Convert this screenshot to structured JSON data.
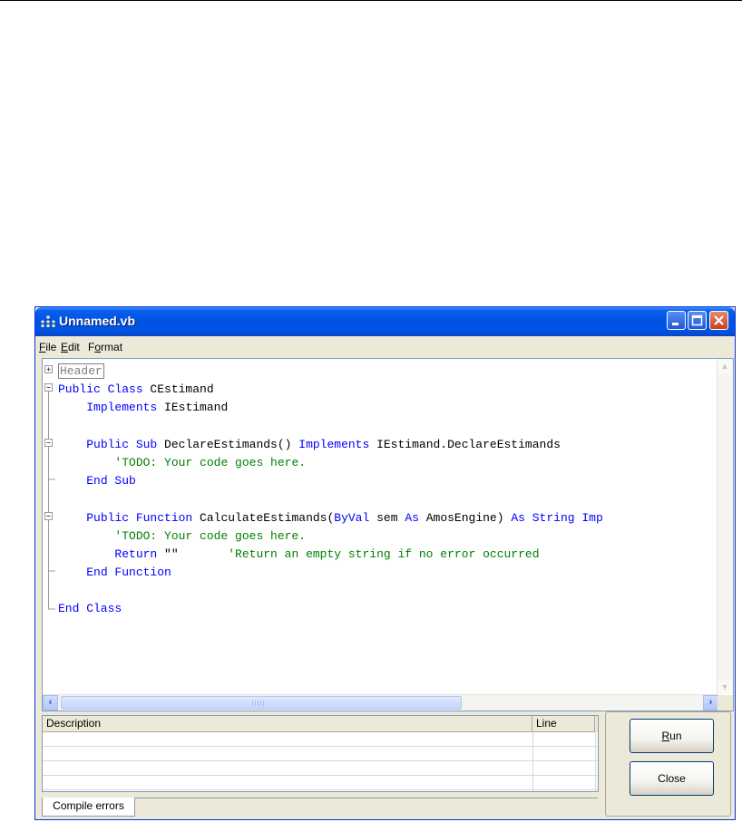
{
  "window": {
    "title": "Unnamed.vb"
  },
  "menu": [
    {
      "mnemonic": "F",
      "rest": "ile"
    },
    {
      "mnemonic": "E",
      "rest": "dit"
    },
    {
      "pre": "F",
      "mnemonic": "o",
      "rest": "rmat"
    }
  ],
  "editor": {
    "lines": [
      [
        {
          "t": "Header",
          "c": "collapsed-box"
        }
      ],
      [
        {
          "t": "Public Class",
          "c": "kw"
        },
        {
          "t": " CEstimand"
        }
      ],
      [
        {
          "t": "    "
        },
        {
          "t": "Implements",
          "c": "kw"
        },
        {
          "t": " IEstimand"
        }
      ],
      [],
      [
        {
          "t": "    "
        },
        {
          "t": "Public Sub",
          "c": "kw"
        },
        {
          "t": " DeclareEstimands() "
        },
        {
          "t": "Implements",
          "c": "kw"
        },
        {
          "t": " IEstimand.DeclareEstimands"
        }
      ],
      [
        {
          "t": "        "
        },
        {
          "t": "'TODO: Your code goes here.",
          "c": "cm"
        }
      ],
      [
        {
          "t": "    "
        },
        {
          "t": "End Sub",
          "c": "kw"
        }
      ],
      [],
      [
        {
          "t": "    "
        },
        {
          "t": "Public Function",
          "c": "kw"
        },
        {
          "t": " CalculateEstimands("
        },
        {
          "t": "ByVal",
          "c": "kw"
        },
        {
          "t": " sem "
        },
        {
          "t": "As",
          "c": "kw"
        },
        {
          "t": " AmosEngine) "
        },
        {
          "t": "As String Imp",
          "c": "kw"
        }
      ],
      [
        {
          "t": "        "
        },
        {
          "t": "'TODO: Your code goes here.",
          "c": "cm"
        }
      ],
      [
        {
          "t": "        "
        },
        {
          "t": "Return",
          "c": "kw"
        },
        {
          "t": " \"\"       "
        },
        {
          "t": "'Return an empty string if no error occurred",
          "c": "cm"
        }
      ],
      [
        {
          "t": "    "
        },
        {
          "t": "End Function",
          "c": "kw"
        }
      ],
      [],
      [
        {
          "t": "End Class",
          "c": "kw"
        }
      ]
    ]
  },
  "errors": {
    "columns": {
      "description": "Description",
      "line": "Line"
    },
    "tab_label": "Compile errors"
  },
  "buttons": {
    "run": {
      "mnemonic": "R",
      "rest": "un"
    },
    "close": "Close"
  }
}
